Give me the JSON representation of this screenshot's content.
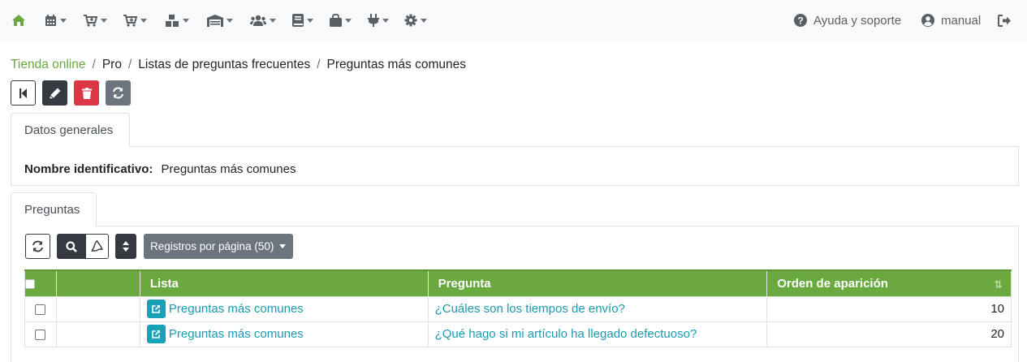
{
  "navbar": {
    "icons": [
      "home-icon",
      "calendar-icon",
      "cart-plus-icon",
      "cart-icon",
      "boxes-icon",
      "warehouse-icon",
      "users-icon",
      "book-icon",
      "shopping-bag-icon",
      "plug-icon",
      "gear-icon"
    ],
    "help_label": "Ayuda y soporte",
    "user_label": "manual"
  },
  "breadcrumb": {
    "items": [
      "Tienda online",
      "Pro",
      "Listas de preguntas frecuentes",
      "Preguntas más comunes"
    ],
    "separator": "/"
  },
  "general": {
    "tab_label": "Datos generales",
    "field_label": "Nombre identificativo:",
    "field_value": "Preguntas más comunes"
  },
  "questions": {
    "tab_label": "Preguntas",
    "per_page_label": "Registros por página (50)",
    "columns": [
      "Lista",
      "Pregunta",
      "Orden de aparición"
    ],
    "sort_glyph": "⇅",
    "rows": [
      {
        "lista": "Preguntas más comunes",
        "pregunta": "¿Cuáles son los tiempos de envío?",
        "orden": "10"
      },
      {
        "lista": "Preguntas más comunes",
        "pregunta": "¿Qué hago si mi artículo ha llegado defectuoso?",
        "orden": "20"
      }
    ]
  },
  "colors": {
    "accent_green": "#6aa93f",
    "link_teal": "#1a9bb0",
    "dark_button": "#343a40",
    "danger_button": "#dc3545",
    "secondary_button": "#6c757d",
    "info_button": "#17a2b8"
  }
}
